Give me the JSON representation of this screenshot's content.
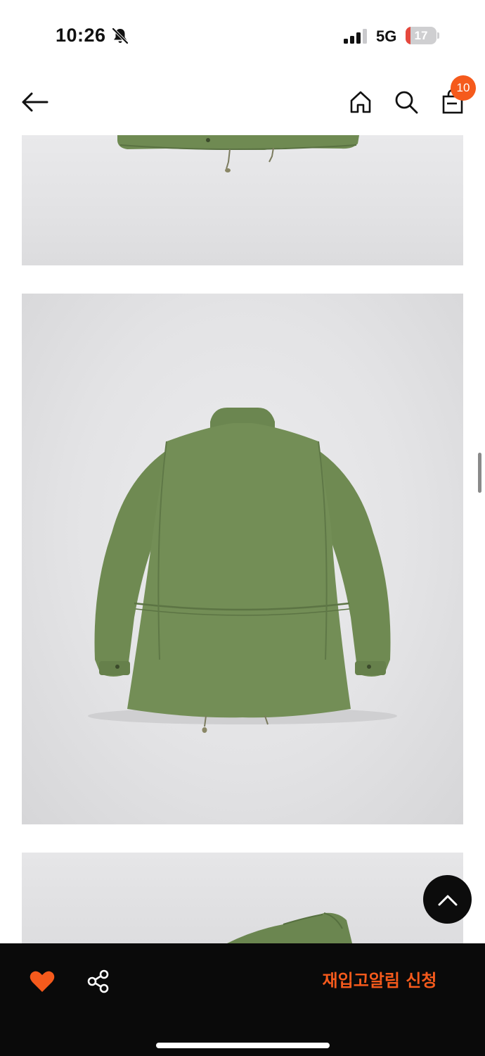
{
  "status_bar": {
    "time": "10:26",
    "network": "5G",
    "battery_level": "17",
    "battery_fraction": 0.17,
    "icons": [
      "bell-slash-icon",
      "cellular-signal-icon",
      "battery-charging-icon"
    ]
  },
  "nav": {
    "icons": [
      "arrow-left-icon",
      "home-icon",
      "search-icon",
      "shopping-bag-icon"
    ],
    "cart_count": "10",
    "badge_color": "#f55a1c"
  },
  "gallery": {
    "images": [
      "product-photo-jacket-hem",
      "product-photo-jacket-back",
      "product-photo-jacket-collar"
    ],
    "background_color": "#e5e5e7",
    "subject_color": "#6f8a52"
  },
  "actions": {
    "back_to_top_icon": "chevron-up-icon",
    "like_icon": "heart-filled-icon",
    "share_icon": "share-icon",
    "restock_label": "재입고알림 신청",
    "accent_color": "#f55a1c",
    "bar_color": "#0a0a0a"
  }
}
